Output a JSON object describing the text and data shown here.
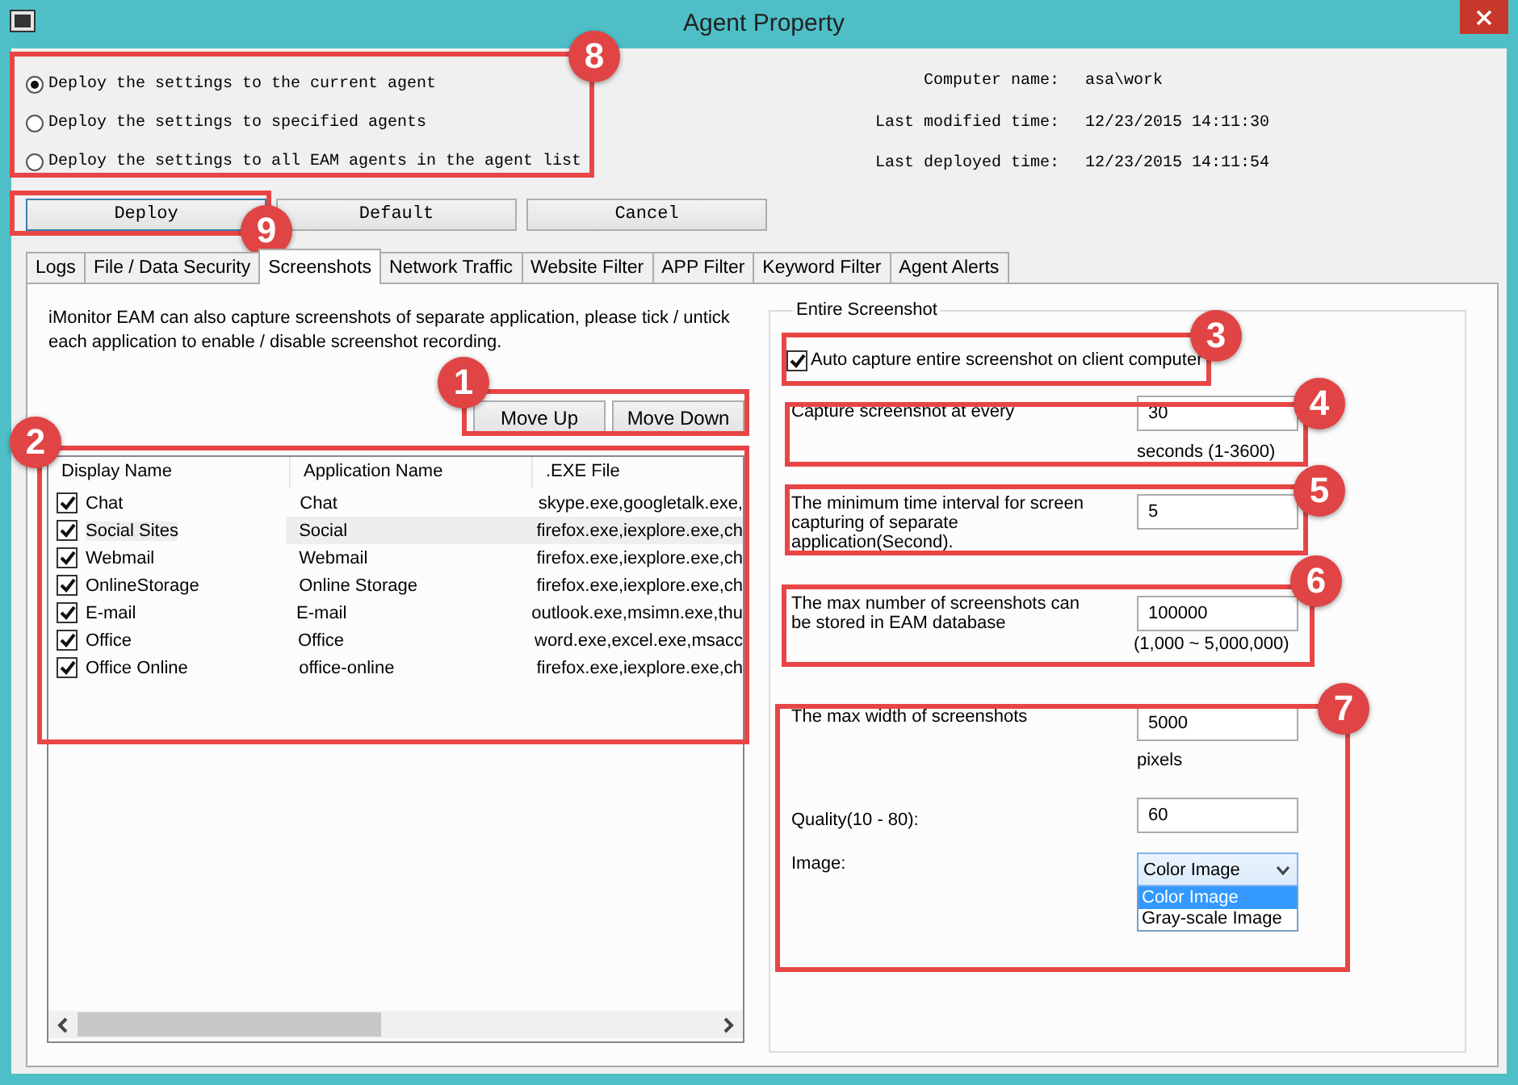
{
  "window": {
    "title": "Agent Property"
  },
  "deploy_options": [
    {
      "label": "Deploy the settings to the current agent",
      "selected": true
    },
    {
      "label": "Deploy the settings to specified agents",
      "selected": false
    },
    {
      "label": "Deploy the settings to all EAM agents in the agent list",
      "selected": false
    }
  ],
  "agent_info": [
    {
      "label": "Computer name:",
      "value": "asa\\work"
    },
    {
      "label": "Last modified time:",
      "value": "12/23/2015 14:11:30"
    },
    {
      "label": "Last deployed time:",
      "value": "12/23/2015 14:11:54"
    }
  ],
  "buttons": [
    "Deploy",
    "Default",
    "Cancel"
  ],
  "tabs": [
    {
      "label": "Logs",
      "selected": false
    },
    {
      "label": "File / Data Security",
      "selected": false
    },
    {
      "label": "Screenshots",
      "selected": true
    },
    {
      "label": "Network Traffic",
      "selected": false
    },
    {
      "label": "Website Filter",
      "selected": false
    },
    {
      "label": "APP Filter",
      "selected": false
    },
    {
      "label": "Keyword Filter",
      "selected": false
    },
    {
      "label": "Agent Alerts",
      "selected": false
    }
  ],
  "description": "iMonitor EAM can also capture screenshots of separate application, please tick / untick each application to enable / disable screenshot recording.",
  "list_buttons": [
    "Move Up",
    "Move Down"
  ],
  "app_table": {
    "columns": [
      "Display Name",
      "Application Name",
      ".EXE File"
    ],
    "rows": [
      {
        "cells": [
          "Chat",
          "Chat",
          "skype.exe,googletalk.exe,"
        ],
        "checked": true,
        "selected": false
      },
      {
        "cells": [
          "Social Sites",
          "Social",
          "firefox.exe,iexplore.exe,ch"
        ],
        "checked": true,
        "selected": true
      },
      {
        "cells": [
          "Webmail",
          "Webmail",
          "firefox.exe,iexplore.exe,ch"
        ],
        "checked": true,
        "selected": false
      },
      {
        "cells": [
          "OnlineStorage",
          "Online Storage",
          "firefox.exe,iexplore.exe,ch"
        ],
        "checked": true,
        "selected": false
      },
      {
        "cells": [
          "E-mail",
          "E-mail",
          "outlook.exe,msimn.exe,thu"
        ],
        "checked": true,
        "selected": false
      },
      {
        "cells": [
          "Office",
          "Office",
          "word.exe,excel.exe,msacc"
        ],
        "checked": true,
        "selected": false
      },
      {
        "cells": [
          "Office Online",
          "office-online",
          "firefox.exe,iexplore.exe,ch"
        ],
        "checked": true,
        "selected": false
      }
    ]
  },
  "entire_screenshot": {
    "title": "Entire Screenshot",
    "auto_capture": {
      "label": "Auto capture entire screenshot on client computer",
      "checked": true
    },
    "settings": [
      {
        "label": "Capture screenshot at every",
        "value": "30",
        "hint": "seconds (1-3600)"
      },
      {
        "label": "The minimum time interval for screen capturing of separate application(Second).",
        "value": "5"
      },
      {
        "label": "The max number of screenshots can be stored in EAM database",
        "value": "100000",
        "hint": "(1,000 ~ 5,000,000)"
      },
      {
        "label": "The max width of screenshots",
        "value": "5000",
        "hint": "pixels"
      },
      {
        "label": "Quality(10 - 80):",
        "value": "60"
      }
    ],
    "image": {
      "label": "Image:",
      "value": "Color Image",
      "options": [
        {
          "label": "Color Image",
          "selected": true
        },
        {
          "label": "Gray-scale Image",
          "selected": false
        }
      ]
    }
  },
  "annotations": [
    {
      "number": "1"
    },
    {
      "number": "2"
    },
    {
      "number": "3"
    },
    {
      "number": "4"
    },
    {
      "number": "5"
    },
    {
      "number": "6"
    },
    {
      "number": "7"
    },
    {
      "number": "8"
    },
    {
      "number": "9"
    }
  ]
}
